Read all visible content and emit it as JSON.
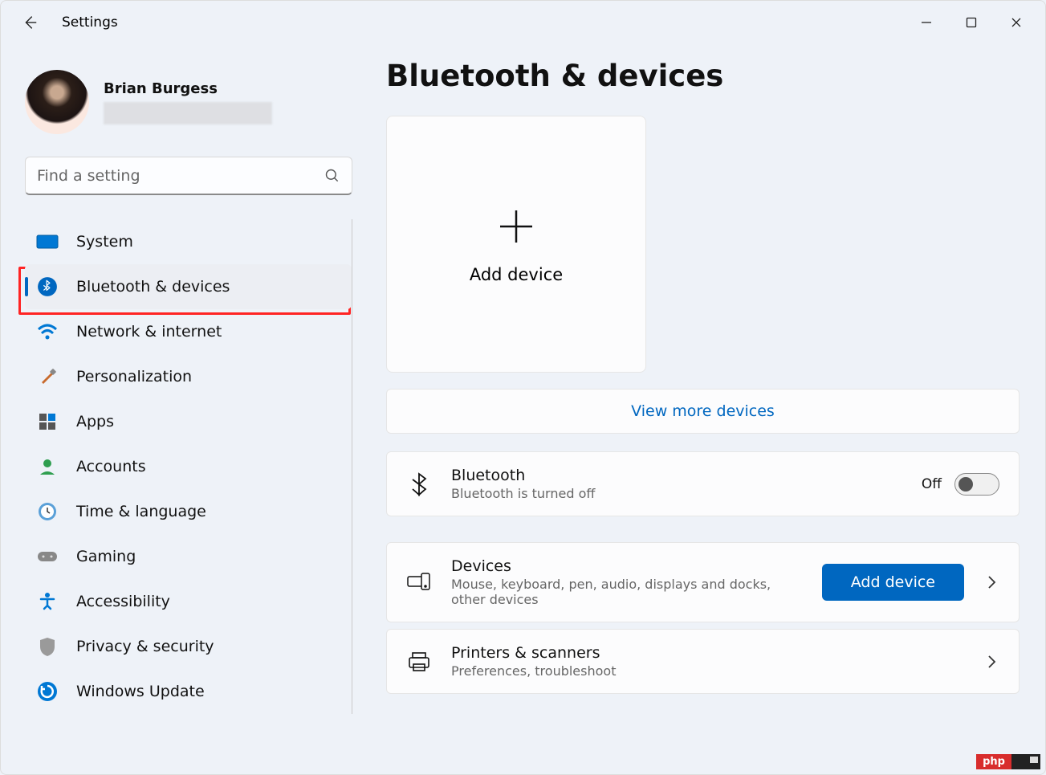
{
  "window": {
    "app_title": "Settings"
  },
  "profile": {
    "username": "Brian Burgess"
  },
  "search": {
    "placeholder": "Find a setting"
  },
  "sidebar": {
    "items": [
      {
        "label": "System",
        "icon": "system-icon"
      },
      {
        "label": "Bluetooth & devices",
        "icon": "bluetooth-icon",
        "active": true
      },
      {
        "label": "Network & internet",
        "icon": "wifi-icon"
      },
      {
        "label": "Personalization",
        "icon": "brush-icon"
      },
      {
        "label": "Apps",
        "icon": "apps-icon"
      },
      {
        "label": "Accounts",
        "icon": "person-icon"
      },
      {
        "label": "Time & language",
        "icon": "clock-icon"
      },
      {
        "label": "Gaming",
        "icon": "gamepad-icon"
      },
      {
        "label": "Accessibility",
        "icon": "accessibility-icon"
      },
      {
        "label": "Privacy & security",
        "icon": "shield-icon"
      },
      {
        "label": "Windows Update",
        "icon": "update-icon"
      }
    ]
  },
  "main": {
    "page_title": "Bluetooth & devices",
    "add_card": {
      "label": "Add device"
    },
    "view_more": "View more devices",
    "bluetooth_card": {
      "title": "Bluetooth",
      "subtitle": "Bluetooth is turned off",
      "toggle_state": "Off"
    },
    "devices_card": {
      "title": "Devices",
      "subtitle": "Mouse, keyboard, pen, audio, displays and docks, other devices",
      "button": "Add device"
    },
    "printers_card": {
      "title": "Printers & scanners",
      "subtitle": "Preferences, troubleshoot"
    }
  },
  "watermark": {
    "text": "php"
  }
}
